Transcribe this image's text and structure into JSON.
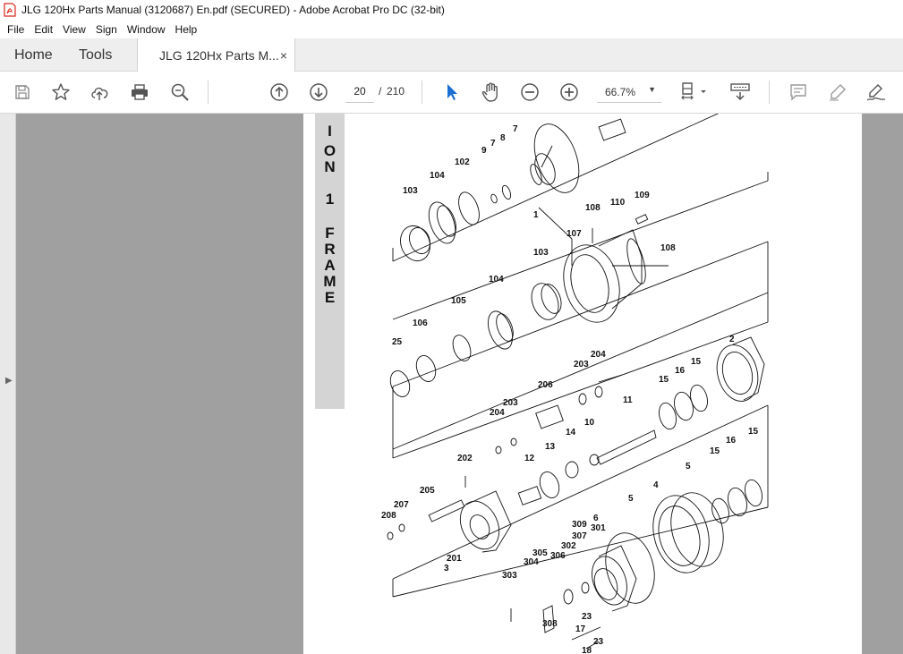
{
  "window": {
    "title": "JLG 120Hx Parts Manual (3120687) En.pdf (SECURED) - Adobe Acrobat Pro DC (32-bit)"
  },
  "menu": [
    "File",
    "Edit",
    "View",
    "Sign",
    "Window",
    "Help"
  ],
  "tabs": {
    "home": "Home",
    "tools": "Tools",
    "document": "JLG 120Hx Parts M...",
    "close_glyph": "×"
  },
  "toolbar": {
    "icons": [
      "save-icon",
      "bookmark-star-icon",
      "upload-cloud-icon",
      "print-icon",
      "zoom-search-icon",
      "previous-page-icon",
      "next-page-icon",
      "select-cursor-icon",
      "hand-tool-icon",
      "zoom-out-icon",
      "zoom-in-icon",
      "fit-page-icon",
      "scroll-mode-icon",
      "comment-icon",
      "highlight-pen-icon",
      "sign-icon"
    ],
    "current_page": "20",
    "page_separator": "/",
    "total_pages": "210",
    "zoom": "66.7%",
    "accent_color": "#1a6fd1"
  },
  "document": {
    "section_tab_letters": [
      "I",
      "O",
      "N",
      "1",
      "F",
      "R",
      "A",
      "M",
      "E"
    ],
    "callouts": [
      {
        "id": "c7a",
        "label": "7"
      },
      {
        "id": "c7b",
        "label": "7"
      },
      {
        "id": "c8",
        "label": "8"
      },
      {
        "id": "c9",
        "label": "9"
      },
      {
        "id": "c102",
        "label": "102"
      },
      {
        "id": "c104a",
        "label": "104"
      },
      {
        "id": "c103a",
        "label": "103"
      },
      {
        "id": "c1",
        "label": "1"
      },
      {
        "id": "c108a",
        "label": "108"
      },
      {
        "id": "c110",
        "label": "110"
      },
      {
        "id": "c109",
        "label": "109"
      },
      {
        "id": "c107",
        "label": "107"
      },
      {
        "id": "c108b",
        "label": "108"
      },
      {
        "id": "c103b",
        "label": "103"
      },
      {
        "id": "c104b",
        "label": "104"
      },
      {
        "id": "c105",
        "label": "105"
      },
      {
        "id": "c106",
        "label": "106"
      },
      {
        "id": "c25",
        "label": "25"
      },
      {
        "id": "c2",
        "label": "2"
      },
      {
        "id": "c15a",
        "label": "15"
      },
      {
        "id": "c16a",
        "label": "16"
      },
      {
        "id": "c15b",
        "label": "15"
      },
      {
        "id": "c204a",
        "label": "204"
      },
      {
        "id": "c203a",
        "label": "203"
      },
      {
        "id": "c206",
        "label": "206"
      },
      {
        "id": "c203b",
        "label": "203"
      },
      {
        "id": "c204b",
        "label": "204"
      },
      {
        "id": "c11",
        "label": "11"
      },
      {
        "id": "c10",
        "label": "10"
      },
      {
        "id": "c14",
        "label": "14"
      },
      {
        "id": "c13",
        "label": "13"
      },
      {
        "id": "c12",
        "label": "12"
      },
      {
        "id": "c202",
        "label": "202"
      },
      {
        "id": "c205",
        "label": "205"
      },
      {
        "id": "c207",
        "label": "207"
      },
      {
        "id": "c208",
        "label": "208"
      },
      {
        "id": "c201",
        "label": "201"
      },
      {
        "id": "c3",
        "label": "3"
      },
      {
        "id": "c15c",
        "label": "15"
      },
      {
        "id": "c16b",
        "label": "16"
      },
      {
        "id": "c15d",
        "label": "15"
      },
      {
        "id": "c5a",
        "label": "5"
      },
      {
        "id": "c5b",
        "label": "5"
      },
      {
        "id": "c4",
        "label": "4"
      },
      {
        "id": "c6",
        "label": "6"
      },
      {
        "id": "c309",
        "label": "309"
      },
      {
        "id": "c301",
        "label": "301"
      },
      {
        "id": "c307",
        "label": "307"
      },
      {
        "id": "c302",
        "label": "302"
      },
      {
        "id": "c305",
        "label": "305"
      },
      {
        "id": "c306",
        "label": "306"
      },
      {
        "id": "c304",
        "label": "304"
      },
      {
        "id": "c303",
        "label": "303"
      },
      {
        "id": "c308",
        "label": "308"
      },
      {
        "id": "c23a",
        "label": "23"
      },
      {
        "id": "c17",
        "label": "17"
      },
      {
        "id": "c23b",
        "label": "23"
      },
      {
        "id": "c18",
        "label": "18"
      }
    ]
  }
}
